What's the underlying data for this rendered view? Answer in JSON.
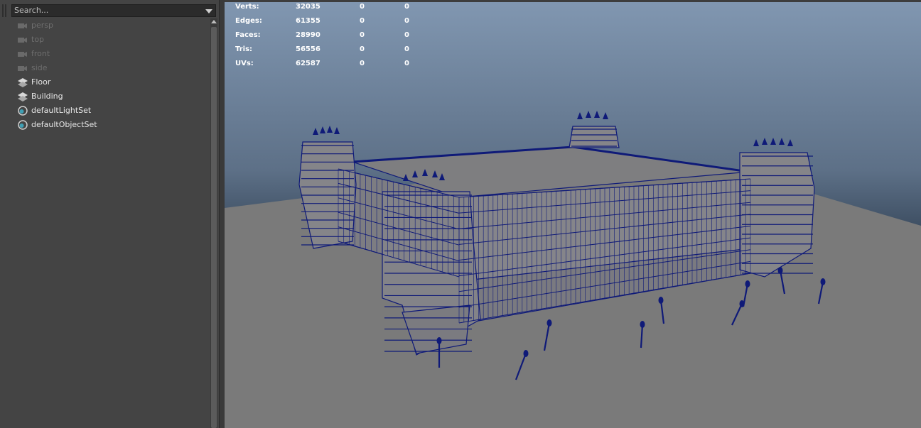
{
  "outliner": {
    "search_placeholder": "Search...",
    "items": [
      {
        "label": "persp",
        "icon": "camera-icon",
        "dim": true
      },
      {
        "label": "top",
        "icon": "camera-icon",
        "dim": true
      },
      {
        "label": "front",
        "icon": "camera-icon",
        "dim": true
      },
      {
        "label": "side",
        "icon": "camera-icon",
        "dim": true
      },
      {
        "label": "Floor",
        "icon": "mesh-transform-icon",
        "dim": false
      },
      {
        "label": "Building",
        "icon": "mesh-transform-icon",
        "dim": false
      },
      {
        "label": "defaultLightSet",
        "icon": "object-set-icon",
        "dim": false
      },
      {
        "label": "defaultObjectSet",
        "icon": "object-set-icon",
        "dim": false
      }
    ]
  },
  "viewport": {
    "hud": [
      {
        "label": "Verts:",
        "value": "32035",
        "col2": "0",
        "col3": "0"
      },
      {
        "label": "Edges:",
        "value": "61355",
        "col2": "0",
        "col3": "0"
      },
      {
        "label": "Faces:",
        "value": "28990",
        "col2": "0",
        "col3": "0"
      },
      {
        "label": "Tris:",
        "value": "56556",
        "col2": "0",
        "col3": "0"
      },
      {
        "label": "UVs:",
        "value": "62587",
        "col2": "0",
        "col3": "0"
      }
    ],
    "colors": {
      "sky_top": "#8197b1",
      "sky_bottom": "#3e4f63",
      "ground": "#7a7a7a",
      "wireframe": "#0f1a78",
      "mesh": "#838386"
    }
  }
}
